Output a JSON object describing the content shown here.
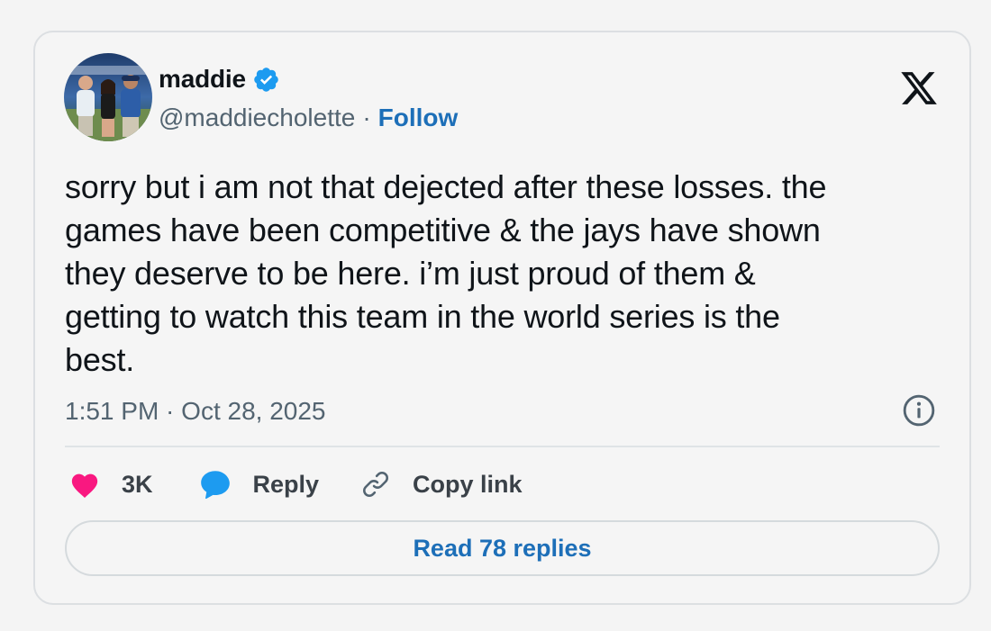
{
  "author": {
    "name": "maddie",
    "handle": "@maddiecholette",
    "separator": "·",
    "follow_label": "Follow",
    "verified": true
  },
  "tweet": {
    "text": "sorry but i am not that dejected after these losses. the\ngames have been competitive & the jays have shown\nthey deserve to be here. i’m just proud of them &\ngetting to watch this team in the world series is the\nbest.",
    "timestamp": "1:51 PM · Oct 28, 2025"
  },
  "actions": {
    "like_count": "3K",
    "reply_label": "Reply",
    "copy_label": "Copy link"
  },
  "read_replies_label": "Read 78 replies",
  "icons": {
    "brand": "x-logo-icon",
    "verified": "verified-badge-icon",
    "like": "heart-icon",
    "reply": "speech-bubble-icon",
    "copy": "link-icon",
    "info": "info-icon"
  },
  "colors": {
    "accent": "#1d6fb8",
    "verified": "#1d9bf0",
    "like": "#f91880",
    "text": "#0f1419",
    "muted": "#536471"
  }
}
